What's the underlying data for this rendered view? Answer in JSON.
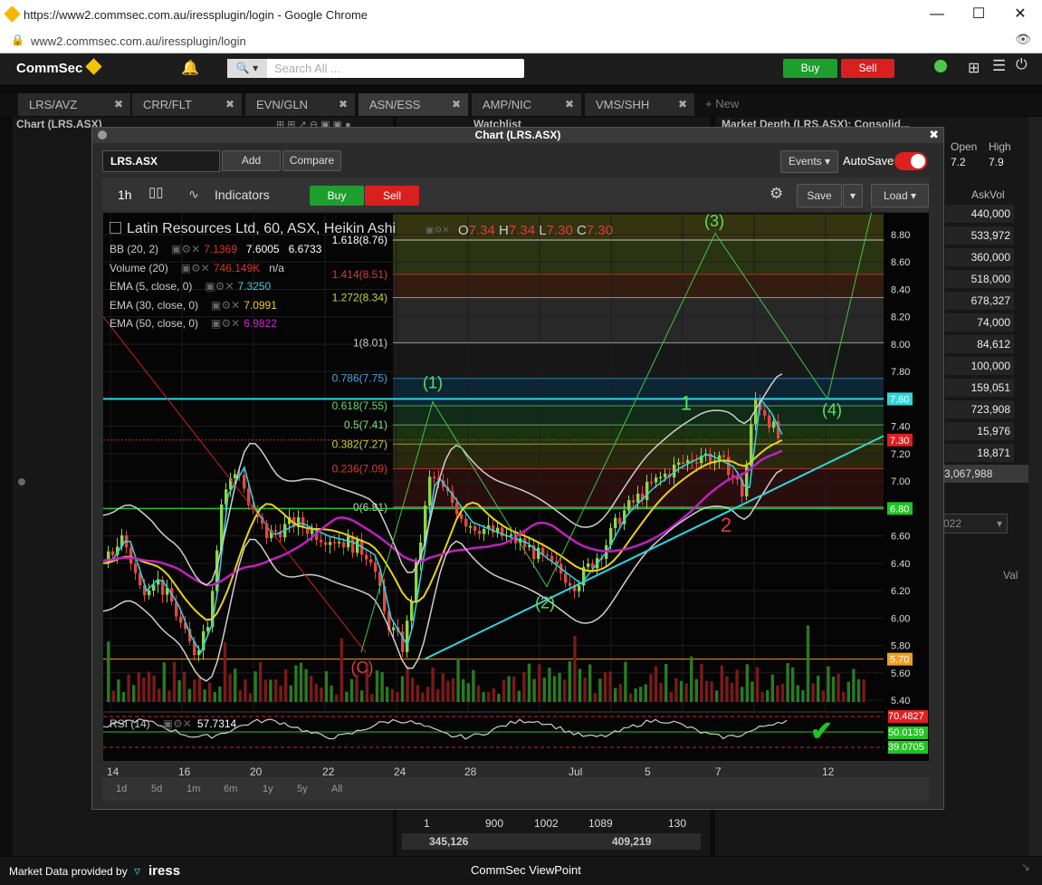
{
  "browser": {
    "title": "https://www2.commsec.com.au/iressplugin/login - Google Chrome",
    "url": "www2.commsec.com.au/iressplugin/login"
  },
  "app": {
    "brand": "CommSec",
    "search_placeholder": "Search All ...",
    "buy_label": "Buy",
    "sell_label": "Sell"
  },
  "tabs": [
    "LRS/AVZ",
    "CRR/FLT",
    "EVN/GLN",
    "ASN/ESS",
    "AMP/NIC",
    "VMS/SHH"
  ],
  "new_tab_label": "+ New",
  "panels": {
    "chart_title": "Chart (LRS.ASX)",
    "watchlist_title": "Watchlist",
    "depth_title": "Market Depth (LRS.ASX): Consolid...",
    "open_label": "Open",
    "high_label": "High",
    "open_value": "7.2",
    "high_value": "7.9",
    "askvol_label": "AskVol",
    "askvols": [
      "440,000",
      "533,972",
      "360,000",
      "518,000",
      "678,327",
      "74,000",
      "84,612",
      "100,000",
      "159,051",
      "723,908",
      "15,976",
      "18,871"
    ],
    "askvol_total": "3,067,988",
    "date_frag": "022",
    "val_frag": "Val",
    "bottom_row": [
      "1",
      "900",
      "1002",
      "1089",
      "130"
    ],
    "bottom_totals": [
      "345,126",
      "409,219"
    ]
  },
  "chart_window": {
    "title": "Chart (LRS.ASX)",
    "symbol": "LRS.ASX",
    "add_label": "Add",
    "compare_label": "Compare",
    "events_label": "Events",
    "autosave_label": "AutoSave",
    "interval": "1h",
    "indicators_label": "Indicators",
    "buy_label": "Buy",
    "sell_label": "Sell",
    "save_label": "Save",
    "load_label": "Load",
    "ranges": [
      "1d",
      "5d",
      "1m",
      "6m",
      "1y",
      "5y",
      "All"
    ]
  },
  "chart_data": {
    "type": "candlestick",
    "title": "Latin Resources Ltd, 60, ASX, Heikin Ashi",
    "ohlc": {
      "O": "7.34",
      "H": "7.34",
      "L": "7.30",
      "C": "7.30"
    },
    "indicators": [
      {
        "name": "BB (20, 2)",
        "values": [
          "7.1369",
          "7.6005",
          "6.6733"
        ],
        "colors": [
          "#e03030",
          "#ffffff",
          "#ffffff"
        ]
      },
      {
        "name": "Volume (20)",
        "values": [
          "746.149K",
          "n/a"
        ],
        "colors": [
          "#e03030",
          "#cccccc"
        ]
      },
      {
        "name": "EMA (5, close, 0)",
        "values": [
          "7.3250"
        ],
        "colors": [
          "#2ed6e0"
        ]
      },
      {
        "name": "EMA (30, close, 0)",
        "values": [
          "7.0991"
        ],
        "colors": [
          "#e8d21a"
        ]
      },
      {
        "name": "EMA (50, close, 0)",
        "values": [
          "6.9822"
        ],
        "colors": [
          "#d020d0"
        ]
      }
    ],
    "y_ticks": [
      "8.80",
      "8.60",
      "8.40",
      "8.20",
      "8.00",
      "7.80",
      "7.60",
      "7.40",
      "7.20",
      "7.00",
      "6.80",
      "6.60",
      "6.40",
      "6.20",
      "6.00",
      "5.80",
      "5.60",
      "5.40"
    ],
    "ylim": [
      5.3,
      8.95
    ],
    "x_ticks": [
      "14",
      "16",
      "20",
      "22",
      "24",
      "28",
      "Jul",
      "5",
      "7",
      "12"
    ],
    "fib_levels": [
      {
        "label": "1.618(8.76)",
        "value": 8.76,
        "color": "#ffffff"
      },
      {
        "label": "1.414(8.51)",
        "value": 8.51,
        "color": "#e03a3a"
      },
      {
        "label": "1.272(8.34)",
        "value": 8.34,
        "color": "#c8d43a"
      },
      {
        "label": "1(8.01)",
        "value": 8.01,
        "color": "#cccccc"
      },
      {
        "label": "0.786(7.75)",
        "value": 7.75,
        "color": "#4aa3e0"
      },
      {
        "label": "0.618(7.55)",
        "value": 7.55,
        "color": "#6bd86b"
      },
      {
        "label": "0.5(7.41)",
        "value": 7.41,
        "color": "#7ee27e"
      },
      {
        "label": "0.382(7.27)",
        "value": 7.27,
        "color": "#c8d43a"
      },
      {
        "label": "0.236(7.09)",
        "value": 7.09,
        "color": "#e03a3a"
      },
      {
        "label": "0(6.81)",
        "value": 6.81,
        "color": "#cccccc"
      }
    ],
    "price_tags": [
      {
        "label": "7.60",
        "value": 7.6,
        "color": "#2ed6e0"
      },
      {
        "label": "7.30",
        "value": 7.3,
        "color": "#e02020"
      },
      {
        "label": "6.80",
        "value": 6.8,
        "color": "#22c422"
      },
      {
        "label": "5.70",
        "value": 5.7,
        "color": "#f0a020"
      }
    ],
    "wave_labels": [
      {
        "text": "(C)",
        "color": "#e03a3a"
      },
      {
        "text": "(1)",
        "color": "#5ee05e"
      },
      {
        "text": "(2)",
        "color": "#5ee05e"
      },
      {
        "text": "(3)",
        "color": "#5ee05e"
      },
      {
        "text": "(4)",
        "color": "#5ee05e"
      },
      {
        "text": "1",
        "color": "#5ee05e"
      },
      {
        "text": "2",
        "color": "#e03a3a"
      }
    ],
    "rsi": {
      "label": "RSI (14)",
      "value": "57.7314",
      "levels": [
        "70.4827",
        "50.0139",
        "39.0705"
      ]
    }
  },
  "footer": {
    "provider": "Market Data provided by",
    "provider_brand": "iress",
    "app_name": "CommSec ViewPoint"
  }
}
